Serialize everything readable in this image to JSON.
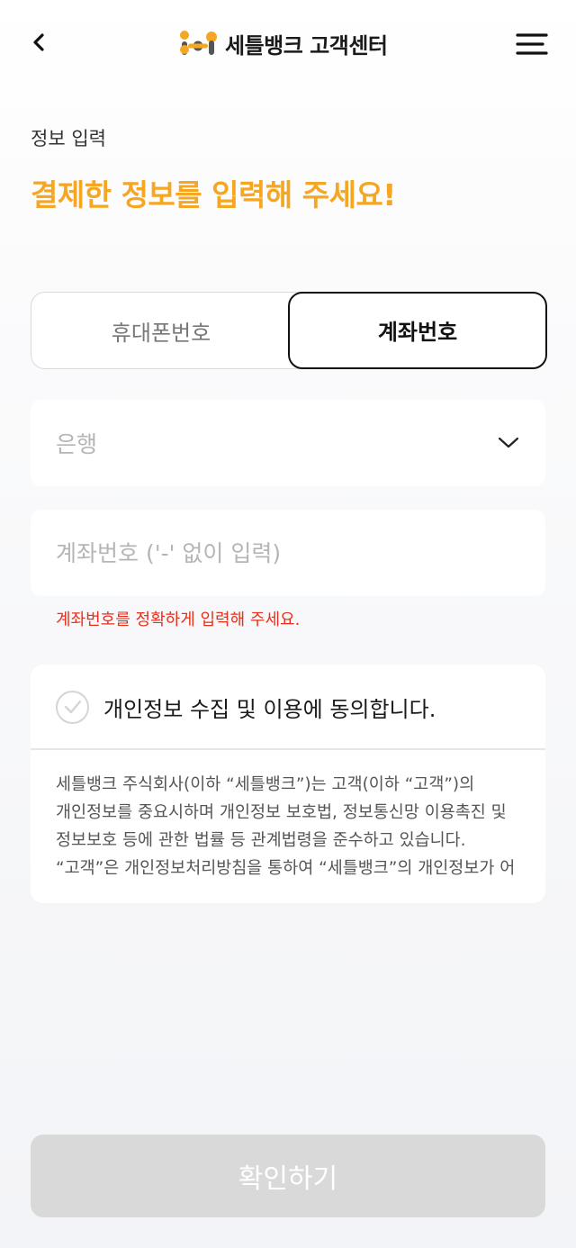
{
  "header": {
    "title": "세틀뱅크 고객센터",
    "brand_colors": {
      "orange": "#f5a623",
      "dark": "#555555"
    }
  },
  "step_label": "정보 입력",
  "page_title": "결제한 정보를 입력해 주세요!",
  "tabs": [
    {
      "label": "휴대폰번호",
      "selected": false
    },
    {
      "label": "계좌번호",
      "selected": true
    }
  ],
  "bank_select": {
    "placeholder": "은행"
  },
  "account_input": {
    "placeholder": "계좌번호 ('-' 없이 입력)",
    "value": ""
  },
  "error_message": "계좌번호를 정확하게 입력해 주세요.",
  "agreement": {
    "label": "개인정보 수집 및 이용에 동의합니다.",
    "checked": false,
    "text": "세틀뱅크 주식회사(이하 “세틀뱅크”)는 고객(이하 “고객”)의 개인정보를 중요시하며 개인정보 보호법, 정보통신망 이용촉진 및 정보보호 등에 관한 법률 등 관계법령을 준수하고 있습니다. “고객”은 개인정보처리방침을 통하여 “세틀뱅크”의 개인정보가 어"
  },
  "confirm_button": {
    "label": "확인하기",
    "enabled": false
  },
  "colors": {
    "accent": "#f5a623",
    "error": "#e5301c",
    "disabled": "#d9d9d9"
  }
}
